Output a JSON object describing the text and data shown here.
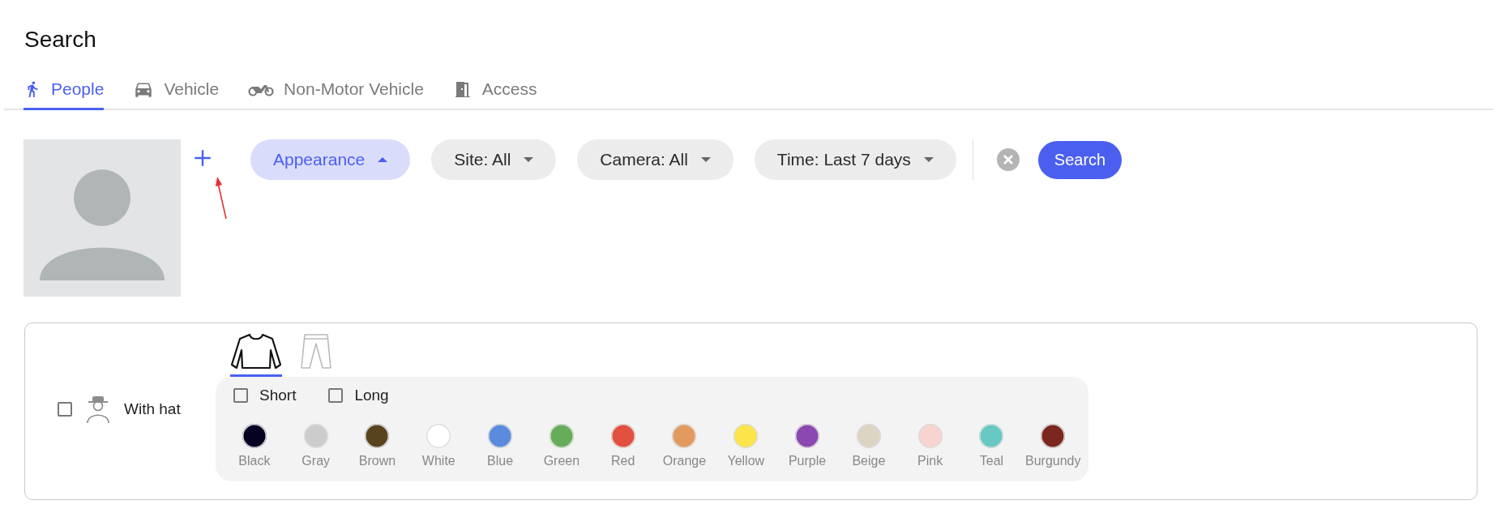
{
  "title": "Search",
  "tabs": [
    {
      "label": "People",
      "kind": "person",
      "selected": true
    },
    {
      "label": "Vehicle",
      "kind": "car",
      "selected": false
    },
    {
      "label": "Non-Motor Vehicle",
      "kind": "motorbike",
      "selected": false
    },
    {
      "label": "Access",
      "kind": "door",
      "selected": false
    }
  ],
  "filters": [
    {
      "label": "Appearance",
      "kind": "toggle",
      "expanded": true
    },
    {
      "label": "Site: All",
      "kind": "dropdown",
      "expanded": false
    },
    {
      "label": "Camera: All",
      "kind": "dropdown",
      "expanded": false
    },
    {
      "label": "Time: Last 7 days",
      "kind": "dropdown",
      "expanded": false
    }
  ],
  "search_button": "Search",
  "hat": {
    "label": "With hat",
    "checked": false
  },
  "garment_tabs": [
    {
      "kind": "top",
      "selected": true
    },
    {
      "kind": "pants",
      "selected": false
    }
  ],
  "sleeves": [
    {
      "label": "Short",
      "checked": false
    },
    {
      "label": "Long",
      "checked": false
    }
  ],
  "colors": [
    {
      "name": "Black",
      "color": "#050321"
    },
    {
      "name": "Gray",
      "color": "#cccccc"
    },
    {
      "name": "Brown",
      "color": "#57441f"
    },
    {
      "name": "White",
      "color": "#ffffff"
    },
    {
      "name": "Blue",
      "color": "#5b8bdc"
    },
    {
      "name": "Green",
      "color": "#66ad5a"
    },
    {
      "name": "Red",
      "color": "#e4503f"
    },
    {
      "name": "Orange",
      "color": "#e39a5f"
    },
    {
      "name": "Yellow",
      "color": "#fce44a"
    },
    {
      "name": "Purple",
      "color": "#8a48b0"
    },
    {
      "name": "Beige",
      "color": "#ddd5c4"
    },
    {
      "name": "Pink",
      "color": "#f7d4cf"
    },
    {
      "name": "Teal",
      "color": "#66c9c2"
    },
    {
      "name": "Burgundy",
      "color": "#7b2720"
    }
  ]
}
